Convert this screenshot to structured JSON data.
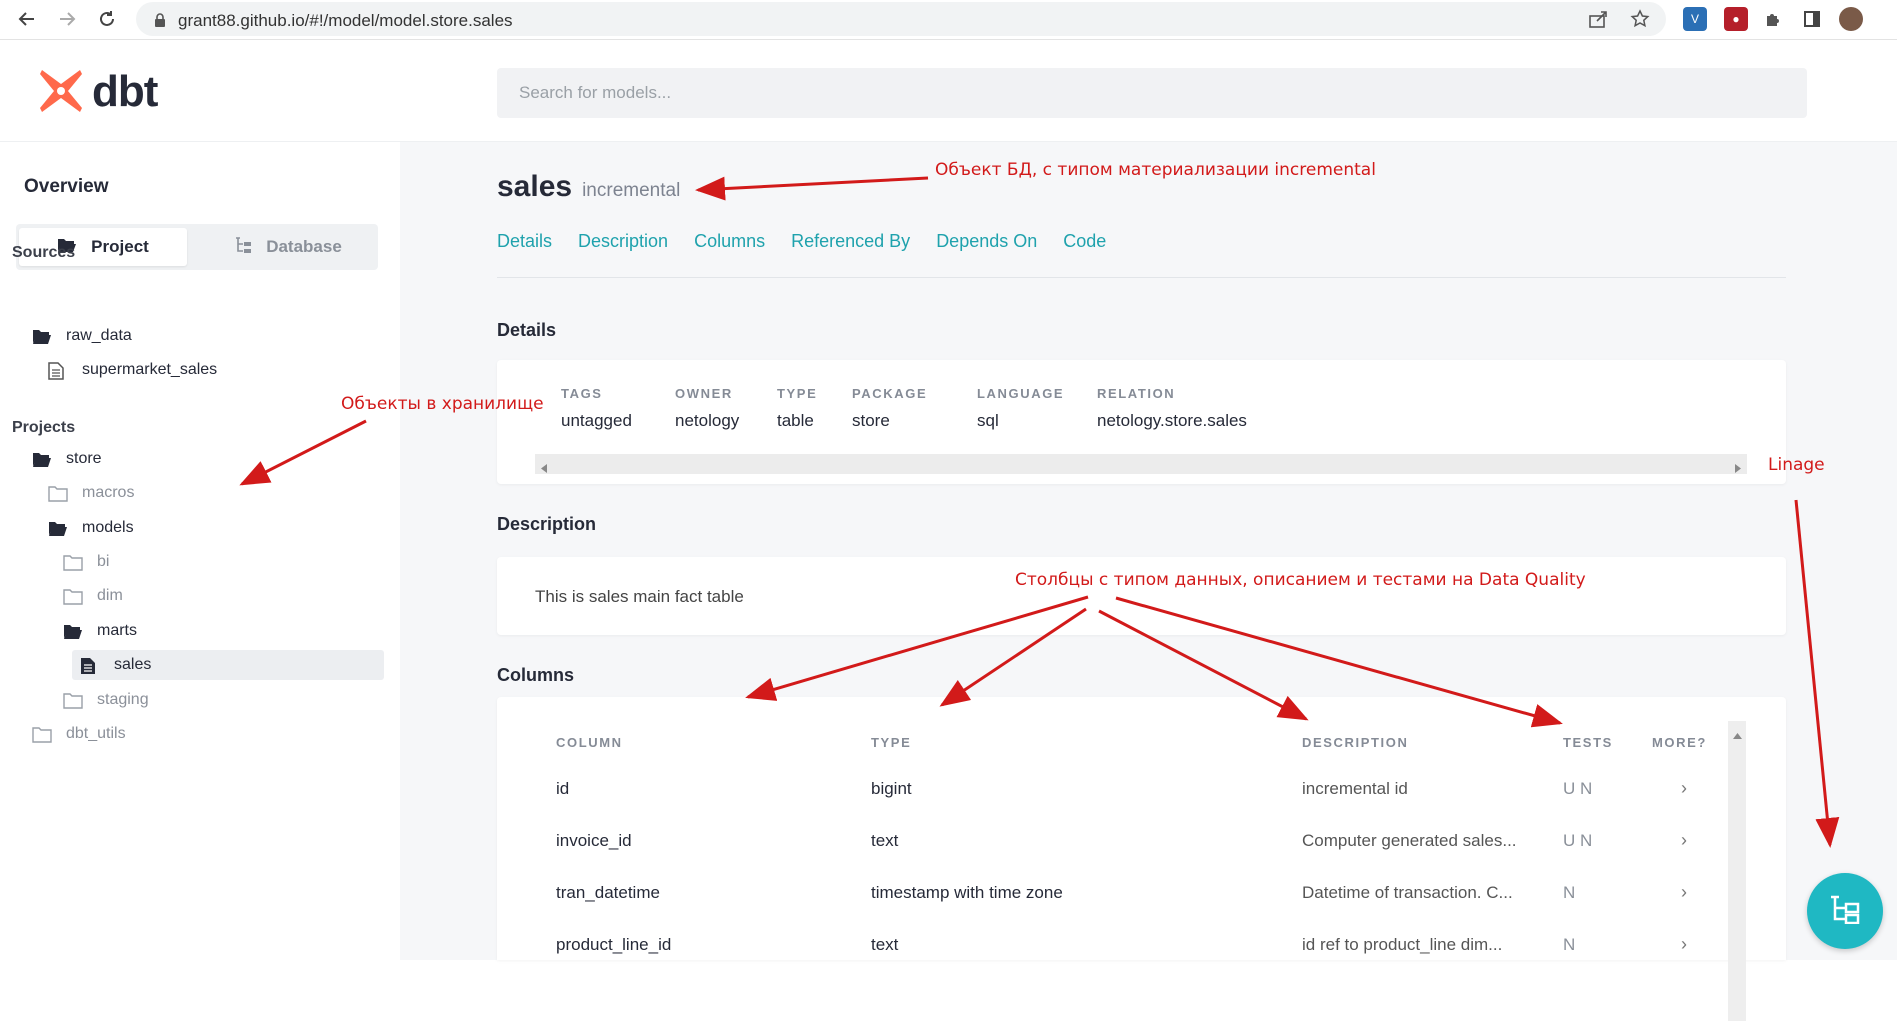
{
  "browser": {
    "url": "grant88.github.io/#!/model/model.store.sales"
  },
  "header": {
    "logo_text": "dbt",
    "search_placeholder": "Search for models..."
  },
  "sidebar": {
    "overview_label": "Overview",
    "toggle": {
      "project": "Project",
      "database": "Database"
    },
    "sources_title": "Sources",
    "sources": [
      {
        "label": "raw_data"
      },
      {
        "label": "supermarket_sales"
      }
    ],
    "projects_title": "Projects",
    "tree": [
      {
        "label": "store"
      },
      {
        "label": "macros"
      },
      {
        "label": "models"
      },
      {
        "label": "bi"
      },
      {
        "label": "dim"
      },
      {
        "label": "marts"
      },
      {
        "label": "sales"
      },
      {
        "label": "staging"
      },
      {
        "label": "dbt_utils"
      }
    ]
  },
  "model": {
    "name": "sales",
    "materialization": "incremental",
    "tabs": [
      "Details",
      "Description",
      "Columns",
      "Referenced By",
      "Depends On",
      "Code"
    ]
  },
  "details": {
    "title": "Details",
    "fields": [
      {
        "label": "TAGS",
        "value": "untagged"
      },
      {
        "label": "OWNER",
        "value": "netology"
      },
      {
        "label": "TYPE",
        "value": "table"
      },
      {
        "label": "PACKAGE",
        "value": "store"
      },
      {
        "label": "LANGUAGE",
        "value": "sql"
      },
      {
        "label": "RELATION",
        "value": "netology.store.sales"
      }
    ]
  },
  "description": {
    "title": "Description",
    "text": "This is sales main fact table"
  },
  "columns": {
    "title": "Columns",
    "headers": [
      "COLUMN",
      "TYPE",
      "DESCRIPTION",
      "TESTS",
      "MORE?"
    ],
    "rows": [
      {
        "column": "id",
        "type": "bigint",
        "description": "incremental id",
        "tests": "U N",
        "more": "›"
      },
      {
        "column": "invoice_id",
        "type": "text",
        "description": "Computer generated sales...",
        "tests": "U N",
        "more": "›"
      },
      {
        "column": "tran_datetime",
        "type": "timestamp with time zone",
        "description": "Datetime of transaction. C...",
        "tests": "N",
        "more": "›"
      },
      {
        "column": "product_line_id",
        "type": "text",
        "description": "id ref to product_line dim...",
        "tests": "N",
        "more": "›"
      }
    ]
  },
  "annotations": {
    "object_db": "Объект БД, с типом материализации incremental",
    "storage_objects": "Объекты в хранилище",
    "linage": "Linage",
    "columns_note": "Столбцы с типом данных, описанием и тестами на Data Quality"
  },
  "colors": {
    "accent": "#1fa2ad",
    "fab": "#1fb8c3",
    "logo": "#ff694b",
    "annotation": "#d21a1a"
  },
  "icons": [
    "back-arrow-icon",
    "forward-arrow-icon",
    "reload-icon",
    "lock-icon",
    "share-icon",
    "star-icon",
    "puzzle-icon",
    "sidepanel-icon",
    "folder-open-icon",
    "folder-icon",
    "file-icon",
    "lineage-icon"
  ]
}
